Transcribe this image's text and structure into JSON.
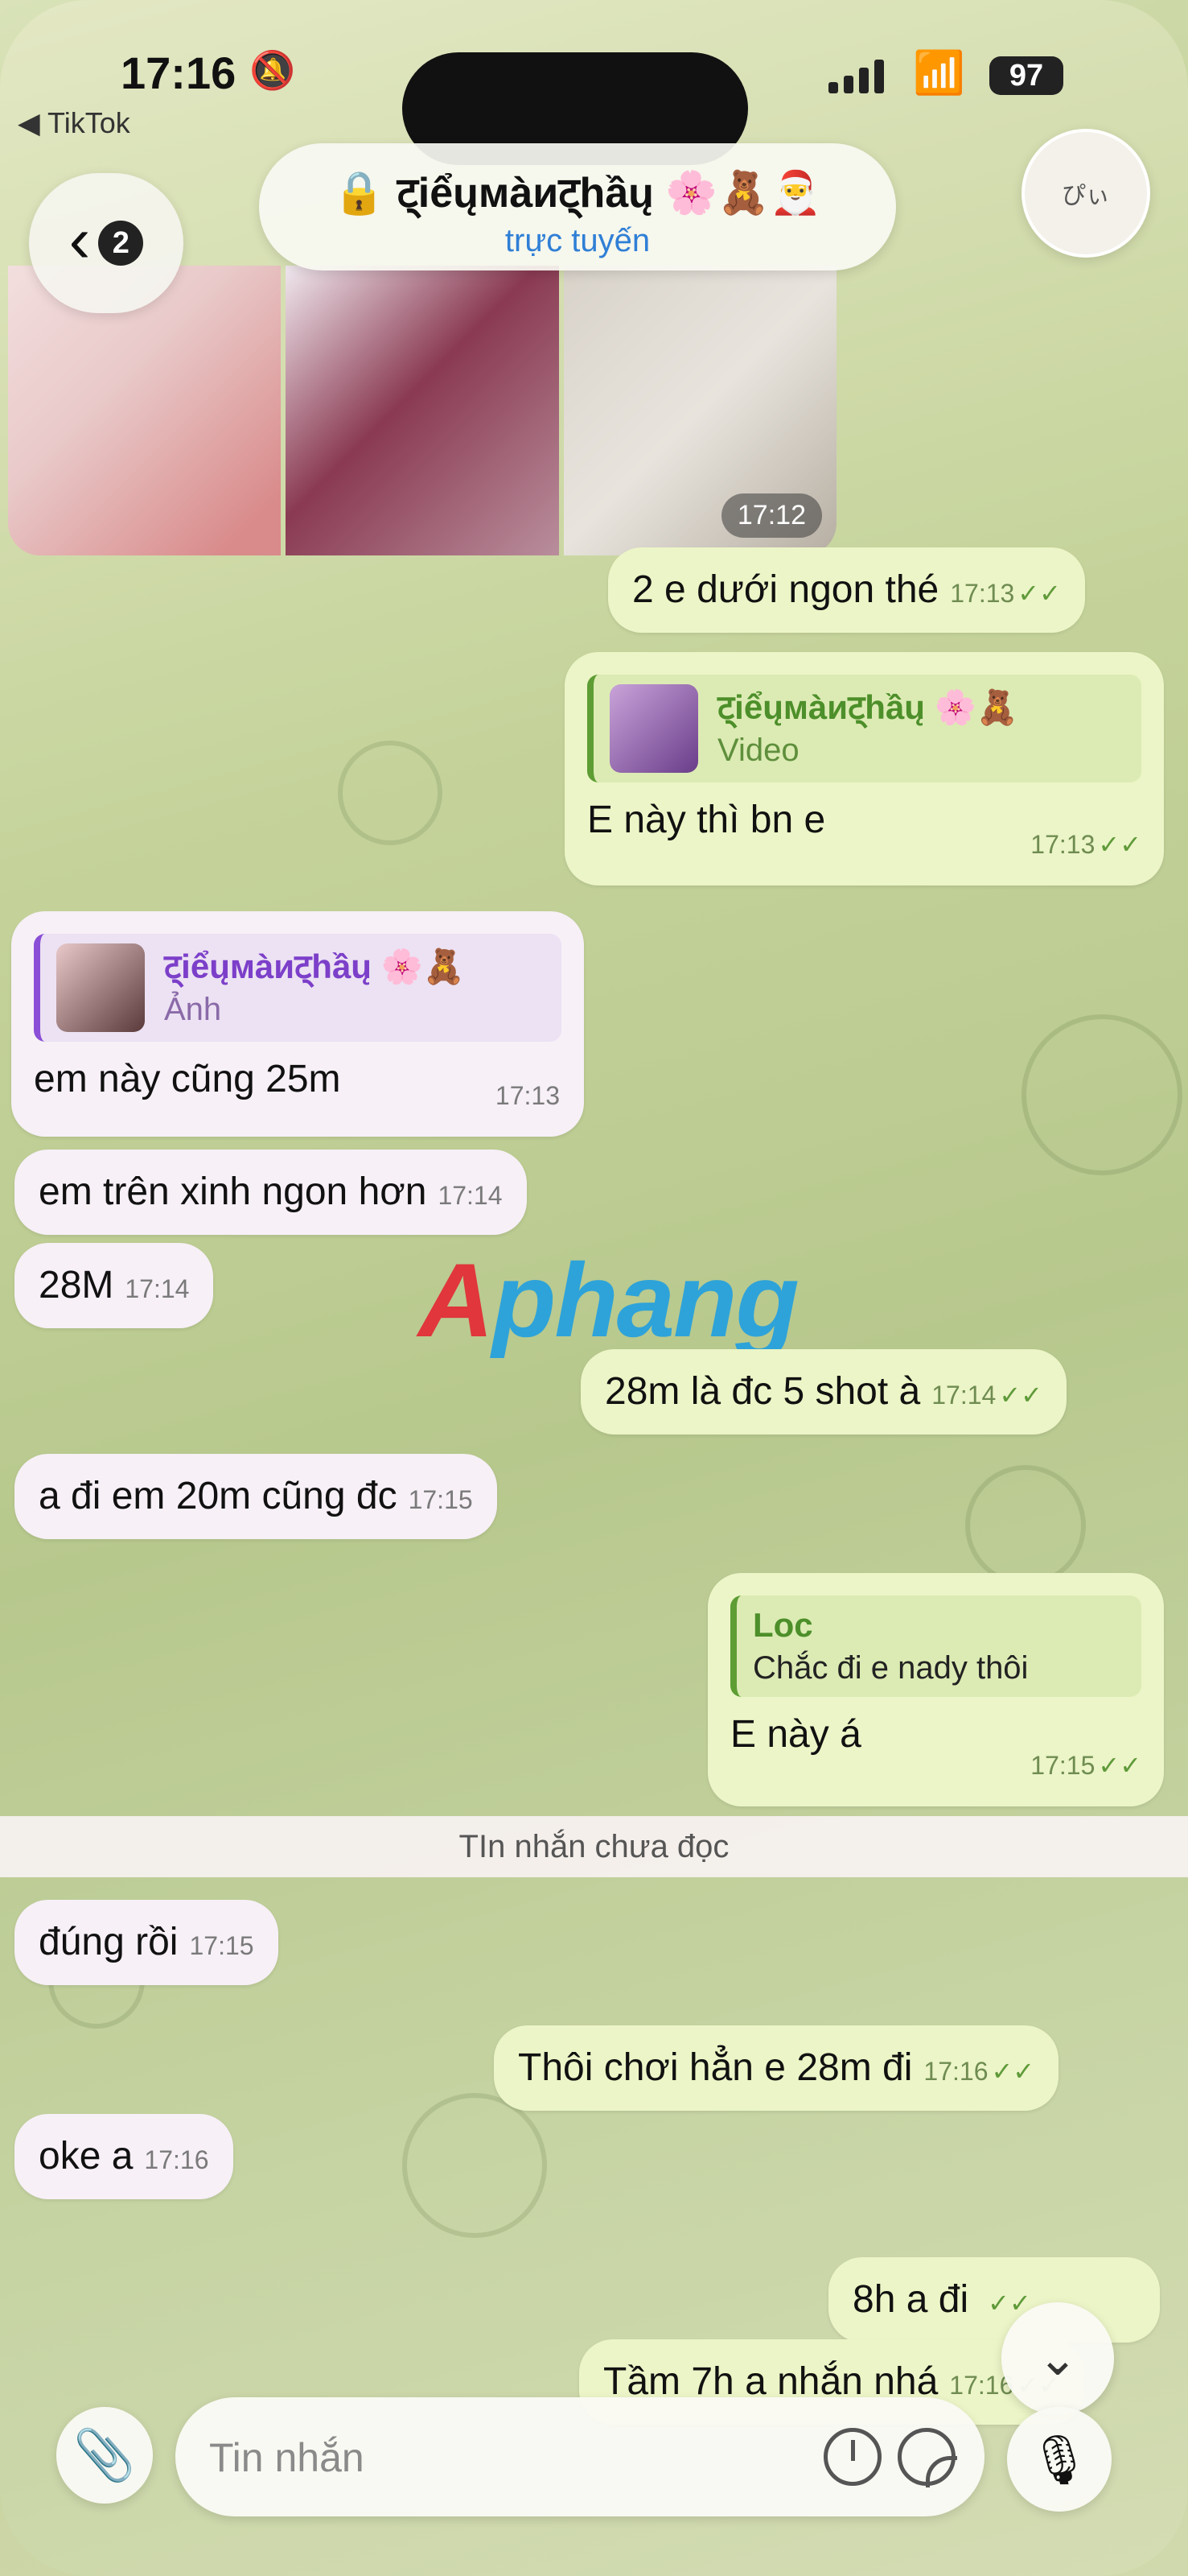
{
  "status_bar": {
    "time": "17:16",
    "battery": "97",
    "back_app": "◀ TikTok"
  },
  "header": {
    "back_count": "2",
    "contact_name": "🔒 ट्iểųмàиट्hầų 🌸🧸🎅",
    "contact_status": "trực tuyến",
    "avatar_label": "ぴぃ"
  },
  "photo_album": {
    "time": "17:12"
  },
  "messages": [
    {
      "dir": "out",
      "text": "2 e dưới ngon thé",
      "time": "17:13",
      "read": true
    },
    {
      "dir": "out",
      "reply_to": {
        "name": "ट्iểųмàиट्hầų 🌸🧸",
        "type": "Video"
      },
      "text": "E này thì bn e",
      "time": "17:13",
      "read": true
    },
    {
      "dir": "in",
      "reply_to": {
        "name": "ट्iểųмàиट्hầų 🌸🧸",
        "type": "Ảnh"
      },
      "text": "em này cũng 25m",
      "time": "17:13"
    },
    {
      "dir": "in",
      "text": "em trên xinh ngon hơn",
      "time": "17:14"
    },
    {
      "dir": "in",
      "text": "28M",
      "time": "17:14"
    },
    {
      "dir": "out",
      "text": "28m là đc 5 shot à",
      "time": "17:14",
      "read": true
    },
    {
      "dir": "in",
      "text": "a đi em 20m cũng đc",
      "time": "17:15"
    },
    {
      "dir": "out",
      "reply_to": {
        "name": "Loc",
        "type": "Chắc đi e nady thôi"
      },
      "text": "E này á",
      "time": "17:15",
      "read": true
    },
    {
      "dir": "in",
      "text": "đúng rồi",
      "time": "17:15"
    },
    {
      "dir": "out",
      "text": "Thôi chơi hẳn e 28m đi",
      "time": "17:16",
      "read": true
    },
    {
      "dir": "in",
      "text": "oke a",
      "time": "17:16"
    },
    {
      "dir": "out",
      "text": "8h a đi",
      "time": "",
      "read": true
    },
    {
      "dir": "out",
      "text": "Tầm 7h a nhắn nhá",
      "time": "17:16",
      "read": true
    }
  ],
  "unread_divider": "TIn nhắn chưa đọc",
  "watermark": {
    "first": "A",
    "rest": "phang"
  },
  "composer": {
    "placeholder": "Tin nhắn"
  },
  "icons": [
    "lock-icon",
    "chevron-left-icon",
    "paperclip-icon",
    "timer-icon",
    "sticker-icon",
    "microphone-icon",
    "chevron-down-icon",
    "double-check-icon"
  ]
}
